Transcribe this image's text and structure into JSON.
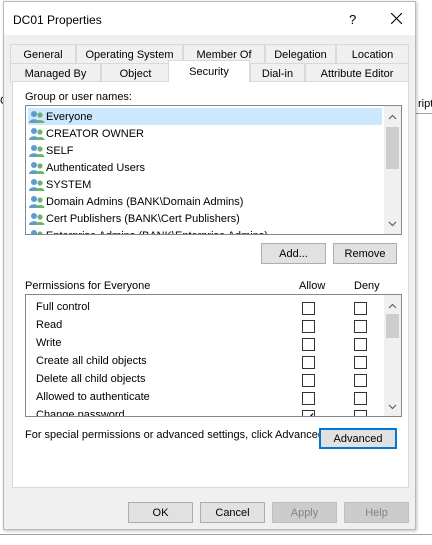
{
  "background": {
    "left_fragment_label": "C",
    "right_fragment_label": "ripti"
  },
  "dialog": {
    "title": "DC01 Properties",
    "help_glyph": "?",
    "tabs_row1": [
      "General",
      "Operating System",
      "Member Of",
      "Delegation",
      "Location"
    ],
    "tabs_row2": [
      "Managed By",
      "Object",
      "Security",
      "Dial-in",
      "Attribute Editor"
    ],
    "active_tab": "Security"
  },
  "security": {
    "group_label": "Group or user names:",
    "principals": [
      "Everyone",
      "CREATOR OWNER",
      "SELF",
      "Authenticated Users",
      "SYSTEM",
      "Domain Admins (BANK\\Domain Admins)",
      "Cert Publishers (BANK\\Cert Publishers)",
      "Enterprise Admins (BANK\\Enterprise Admins)"
    ],
    "selected_principal": "Everyone",
    "add_button": "Add...",
    "remove_button": "Remove",
    "permissions_label": "Permissions for Everyone",
    "allow_header": "Allow",
    "deny_header": "Deny",
    "permissions": [
      {
        "name": "Full control",
        "allow": false,
        "deny": false
      },
      {
        "name": "Read",
        "allow": false,
        "deny": false
      },
      {
        "name": "Write",
        "allow": false,
        "deny": false
      },
      {
        "name": "Create all child objects",
        "allow": false,
        "deny": false
      },
      {
        "name": "Delete all child objects",
        "allow": false,
        "deny": false
      },
      {
        "name": "Allowed to authenticate",
        "allow": false,
        "deny": false
      },
      {
        "name": "Change password",
        "allow": true,
        "deny": false
      }
    ],
    "advanced_text": "For special permissions or advanced settings, click Advanced.",
    "advanced_button": "Advanced"
  },
  "footer": {
    "ok": "OK",
    "cancel": "Cancel",
    "apply": "Apply",
    "help": "Help"
  },
  "colors": {
    "selection": "#cce8ff",
    "focus_border": "#0078d7",
    "dialog_bg": "#f0f0f0"
  }
}
